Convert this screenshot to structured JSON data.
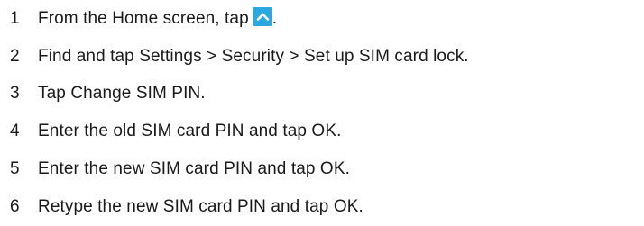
{
  "steps": [
    {
      "number": "1",
      "text_before": "From the Home screen, tap",
      "icon": "chevron-up-icon",
      "icon_color": "#2aa8e0",
      "text_after": "."
    },
    {
      "number": "2",
      "text": "Find and tap Settings > Security > Set up SIM card lock."
    },
    {
      "number": "3",
      "text": "Tap Change SIM PIN."
    },
    {
      "number": "4",
      "text": "Enter the old SIM card PIN and tap OK."
    },
    {
      "number": "5",
      "text": "Enter the new SIM card PIN and tap OK."
    },
    {
      "number": "6",
      "text": "Retype the new SIM card PIN and tap OK."
    }
  ]
}
